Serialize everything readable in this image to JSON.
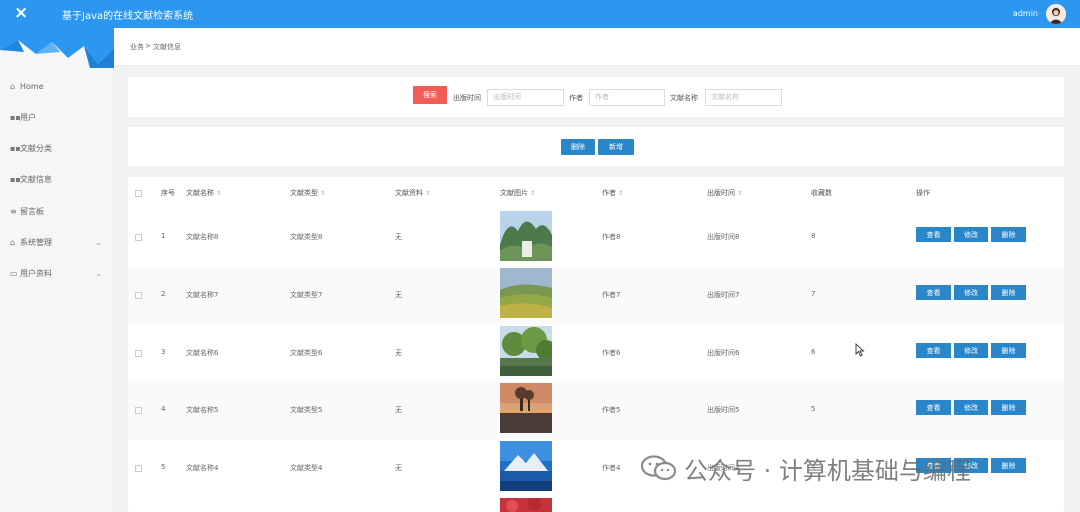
{
  "header": {
    "close_icon": "×",
    "title": "基于Java的在线文献检索系统",
    "user": "admin"
  },
  "sidebar": {
    "items": [
      {
        "icon": "home-icon",
        "label": "Home",
        "expandable": false
      },
      {
        "icon": "grid-icon",
        "label": "用户",
        "expandable": false
      },
      {
        "icon": "grid-icon",
        "label": "文献分类",
        "expandable": false
      },
      {
        "icon": "grid-icon",
        "label": "文献信息",
        "expandable": false
      },
      {
        "icon": "list-icon",
        "label": "留言板",
        "expandable": false
      },
      {
        "icon": "bank-icon",
        "label": "系统管理",
        "expandable": true
      },
      {
        "icon": "card-icon",
        "label": "用户资料",
        "expandable": true
      }
    ]
  },
  "breadcrumb": {
    "home": "业务",
    "sep": ">",
    "current": "文献信息"
  },
  "search": {
    "button": "搜索",
    "publish_time_label": "出版时间",
    "publish_time_placeholder": "出版时间",
    "author_label": "作者",
    "author_placeholder": "作者",
    "name_label": "文献名称",
    "name_placeholder": "文献名称"
  },
  "actions": {
    "delete": "删除",
    "add": "新增"
  },
  "table": {
    "headers": [
      "序号",
      "文献名称",
      "文献类型",
      "文献资料",
      "文献图片",
      "作者",
      "出版时间",
      "收藏数",
      "操作"
    ],
    "sortable": [
      false,
      true,
      true,
      true,
      true,
      true,
      true,
      false,
      false
    ],
    "rows": [
      {
        "idx": "1",
        "name": "文献名称8",
        "type": "文献类型8",
        "material": "无",
        "author": "作者8",
        "time": "出版时间8",
        "fav": "8"
      },
      {
        "idx": "2",
        "name": "文献名称7",
        "type": "文献类型7",
        "material": "无",
        "author": "作者7",
        "time": "出版时间7",
        "fav": "7"
      },
      {
        "idx": "3",
        "name": "文献名称6",
        "type": "文献类型6",
        "material": "无",
        "author": "作者6",
        "time": "出版时间6",
        "fav": "6"
      },
      {
        "idx": "4",
        "name": "文献名称5",
        "type": "文献类型5",
        "material": "无",
        "author": "作者5",
        "time": "出版时间5",
        "fav": "5"
      },
      {
        "idx": "5",
        "name": "文献名称4",
        "type": "文献类型4",
        "material": "无",
        "author": "作者4",
        "time": "出版时间4",
        "fav": "4"
      }
    ],
    "row_buttons": {
      "view": "查看",
      "edit": "修改",
      "delete": "删除"
    }
  },
  "watermark": {
    "text": "公众号 · 计算机基础与编程"
  },
  "colors": {
    "topbar": "#2b97f1",
    "primary_button": "#2a86c9",
    "search_button": "#f35c55"
  }
}
